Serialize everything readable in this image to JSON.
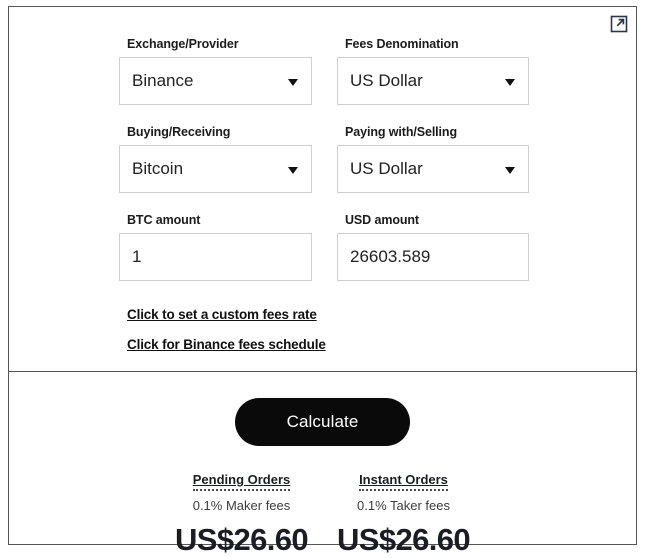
{
  "window": {
    "external_link_icon": "external-link-icon"
  },
  "form": {
    "rows": [
      {
        "left": {
          "label": "Exchange/Provider",
          "value": "Binance",
          "kind": "select"
        },
        "right": {
          "label": "Fees Denomination",
          "value": "US Dollar",
          "kind": "select"
        }
      },
      {
        "left": {
          "label": "Buying/Receiving",
          "value": "Bitcoin",
          "kind": "select"
        },
        "right": {
          "label": "Paying with/Selling",
          "value": "US Dollar",
          "kind": "select"
        }
      },
      {
        "left": {
          "label": "BTC amount",
          "value": "1",
          "kind": "text"
        },
        "right": {
          "label": "USD amount",
          "value": "26603.589",
          "kind": "text"
        }
      }
    ],
    "links": [
      {
        "label": "Click to set a custom fees rate"
      },
      {
        "label": "Click for Binance fees schedule"
      }
    ]
  },
  "results": {
    "calculate_label": "Calculate",
    "columns": [
      {
        "title": "Pending Orders",
        "subtitle": "0.1% Maker fees",
        "value": "US$26.60"
      },
      {
        "title": "Instant Orders",
        "subtitle": "0.1% Taker fees",
        "value": "US$26.60"
      }
    ]
  },
  "colors": {
    "accent": "#0a0a0a",
    "border": "#565656",
    "field_border": "#cfcfcf",
    "icon": "#27374d"
  }
}
